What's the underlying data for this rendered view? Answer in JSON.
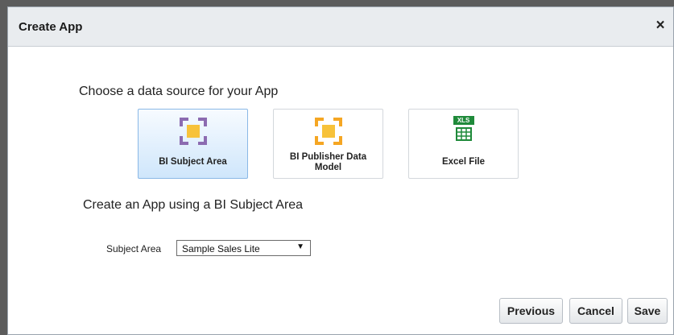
{
  "dialog": {
    "title": "Create App",
    "close_label": "×"
  },
  "source": {
    "heading": "Choose a data source for your App",
    "options": [
      {
        "label": "BI Subject Area",
        "icon": "subject-area-icon",
        "selected": true
      },
      {
        "label": "BI Publisher Data Model",
        "icon": "data-model-icon",
        "selected": false
      },
      {
        "label": "Excel File",
        "icon": "excel-file-icon",
        "badge": "XLS",
        "selected": false
      }
    ]
  },
  "subject": {
    "heading": "Create an App using a BI Subject Area",
    "label": "Subject Area",
    "value": "Sample Sales Lite",
    "arrow": "▼"
  },
  "buttons": {
    "previous": "Previous",
    "cancel": "Cancel",
    "save": "Save"
  },
  "colors": {
    "subject_area_frame": "#8c6bb1",
    "data_model_frame": "#f5a623",
    "center_square": "#f7c23a",
    "excel_green": "#1f8a3a"
  }
}
